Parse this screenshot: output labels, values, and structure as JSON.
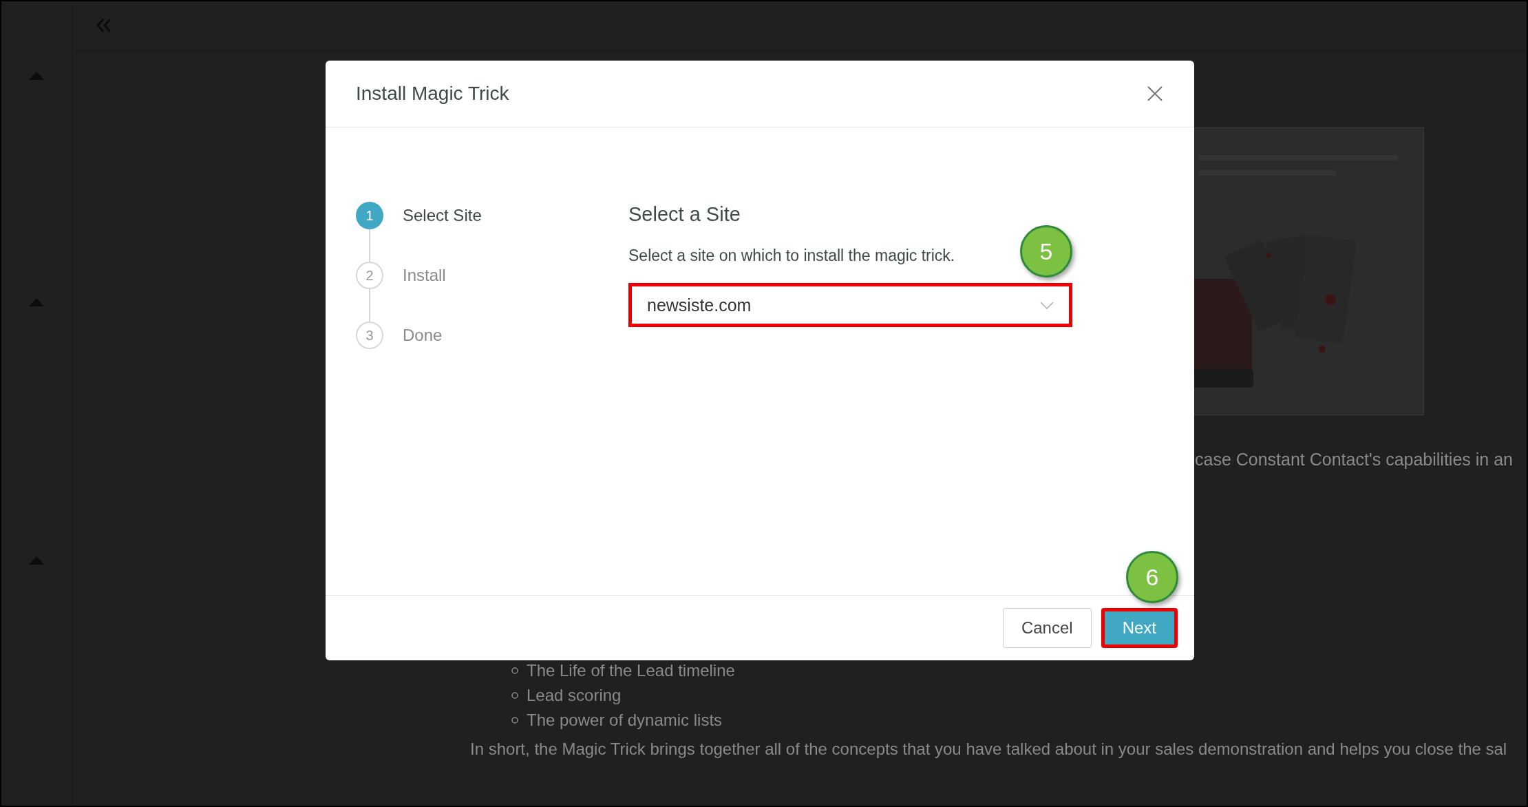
{
  "modal": {
    "title": "Install Magic Trick",
    "steps": [
      {
        "number": "1",
        "label": "Select Site",
        "selected": true
      },
      {
        "number": "2",
        "label": "Install",
        "selected": false
      },
      {
        "number": "3",
        "label": "Done",
        "selected": false
      }
    ],
    "heading": "Select a Site",
    "description": "Select a site on which to install the magic trick.",
    "site_select": {
      "value": "newsiste.com",
      "highlighted": true
    },
    "buttons": [
      {
        "label": "Cancel",
        "kind": "secondary",
        "highlighted": false
      },
      {
        "label": "Next",
        "kind": "primary",
        "highlighted": true
      }
    ]
  },
  "annotations": [
    {
      "label": "5"
    },
    {
      "label": "6"
    }
  ],
  "background": {
    "text_fragment": "case Constant Contact's capabilities in an",
    "list": [
      "The Life of the Lead timeline",
      "Lead scoring",
      "The power of dynamic lists"
    ],
    "paragraph": "In short, the Magic Trick brings together all of the concepts that you have talked about in your sales demonstration and helps you close the sal"
  }
}
